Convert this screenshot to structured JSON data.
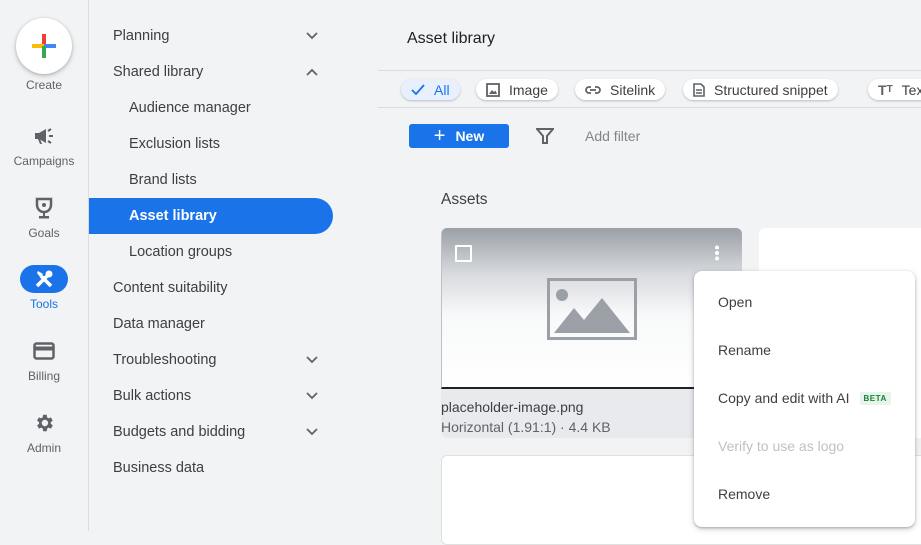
{
  "rail": {
    "create": "Create",
    "items": [
      {
        "label": "Campaigns",
        "icon": "megaphone-icon"
      },
      {
        "label": "Goals",
        "icon": "trophy-icon"
      },
      {
        "label": "Tools",
        "icon": "tools-icon",
        "active": true
      },
      {
        "label": "Billing",
        "icon": "credit-card-icon"
      },
      {
        "label": "Admin",
        "icon": "gear-icon"
      }
    ]
  },
  "subnav": {
    "items": [
      {
        "label": "Planning",
        "level": "top",
        "chevron": "down"
      },
      {
        "label": "Shared library",
        "level": "top",
        "chevron": "up"
      },
      {
        "label": "Audience manager",
        "level": "sub"
      },
      {
        "label": "Exclusion lists",
        "level": "sub"
      },
      {
        "label": "Brand lists",
        "level": "sub"
      },
      {
        "label": "Asset library",
        "level": "sub",
        "active": true
      },
      {
        "label": "Location groups",
        "level": "sub"
      },
      {
        "label": "Content suitability",
        "level": "top"
      },
      {
        "label": "Data manager",
        "level": "top"
      },
      {
        "label": "Troubleshooting",
        "level": "top",
        "chevron": "down"
      },
      {
        "label": "Bulk actions",
        "level": "top",
        "chevron": "down"
      },
      {
        "label": "Budgets and bidding",
        "level": "top",
        "chevron": "down"
      },
      {
        "label": "Business data",
        "level": "top"
      }
    ]
  },
  "main": {
    "title": "Asset library",
    "chips": [
      {
        "label": "All",
        "icon": "check-icon",
        "selected": true
      },
      {
        "label": "Image",
        "icon": "image-icon"
      },
      {
        "label": "Sitelink",
        "icon": "link-icon"
      },
      {
        "label": "Structured snippet",
        "icon": "document-icon"
      },
      {
        "label": "Text",
        "icon": "text-format-icon"
      }
    ],
    "new_button": "New",
    "add_filter": "Add filter",
    "section_title": "Assets",
    "asset": {
      "name": "placeholder-image.png",
      "meta": "Horizontal (1.91:1) · 4.4 KB"
    }
  },
  "context_menu": {
    "items": [
      {
        "label": "Open"
      },
      {
        "label": "Rename"
      },
      {
        "label": "Copy and edit with AI",
        "badge": "BETA"
      },
      {
        "label": "Verify to use as logo",
        "disabled": true
      },
      {
        "label": "Remove"
      }
    ]
  },
  "colors": {
    "accent": "#1a73e8",
    "background": "#f1f3f4",
    "beta_bg": "#e6f4ea",
    "beta_text": "#188038"
  }
}
